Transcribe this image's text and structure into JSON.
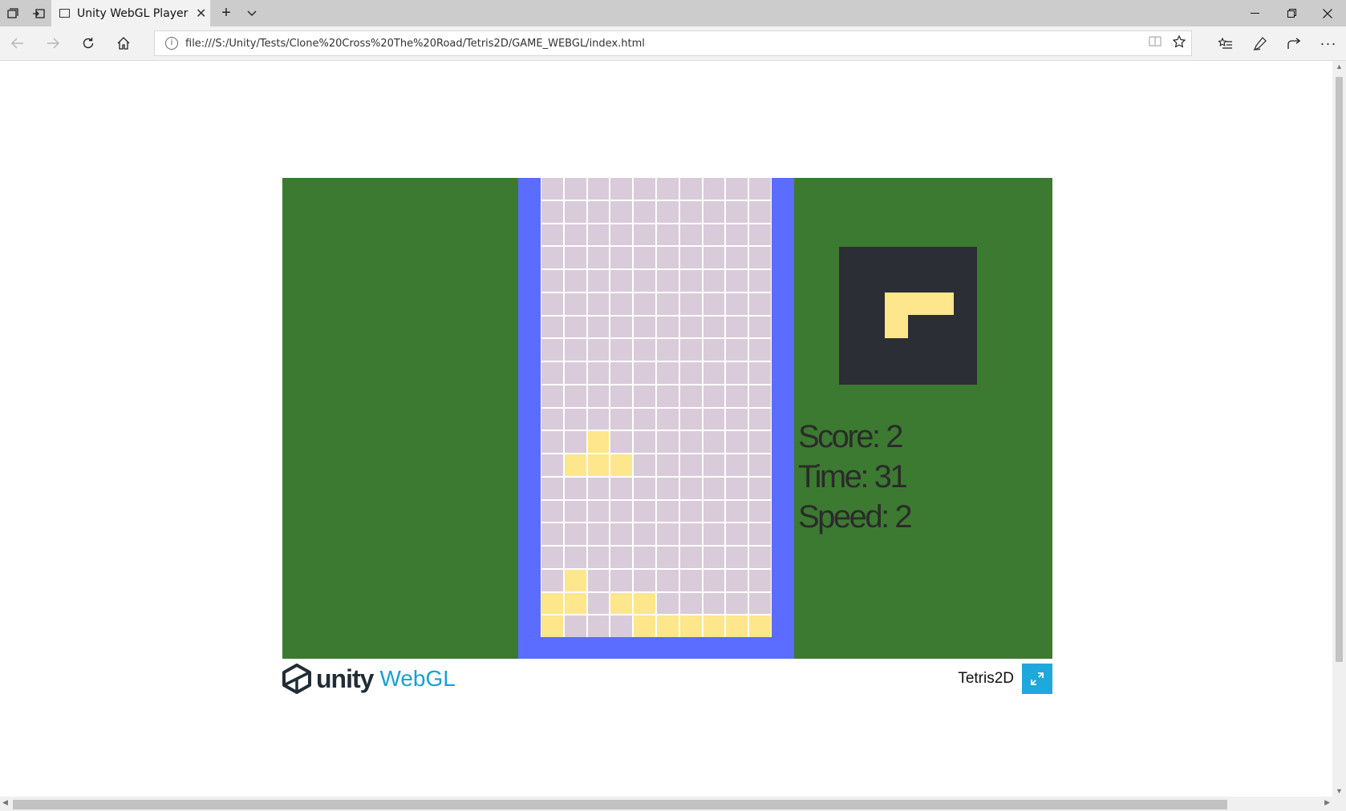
{
  "browser": {
    "tab_title": "Unity WebGL Player | Te",
    "url": "file:///S:/Unity/Tests/Clone%20Cross%20The%20Road/Tetris2D/GAME_WEBGL/index.html"
  },
  "game": {
    "score_text": "Score: 2",
    "time_text": "Time: 31",
    "speed_text": "Speed: 2",
    "board": {
      "columns": 10,
      "rows": 20,
      "filled_cells": [
        [
          11,
          2
        ],
        [
          12,
          1
        ],
        [
          12,
          2
        ],
        [
          12,
          3
        ],
        [
          17,
          1
        ],
        [
          18,
          0
        ],
        [
          18,
          1
        ],
        [
          18,
          3
        ],
        [
          18,
          4
        ],
        [
          19,
          0
        ],
        [
          19,
          4
        ],
        [
          19,
          5
        ],
        [
          19,
          6
        ],
        [
          19,
          7
        ],
        [
          19,
          8
        ],
        [
          19,
          9
        ]
      ]
    },
    "next_piece": "L",
    "colors": {
      "background": "#3c7a31",
      "well": "#5b6dff",
      "empty_cell": "#d9cbd9",
      "block": "#fde68b",
      "next_box": "#2b2e35"
    }
  },
  "footer": {
    "logo_unity": "unity",
    "logo_webgl": "WebGL",
    "game_title": "Tetris2D"
  },
  "icons": {
    "fullscreen": "fullscreen-icon",
    "info": "info-icon"
  }
}
